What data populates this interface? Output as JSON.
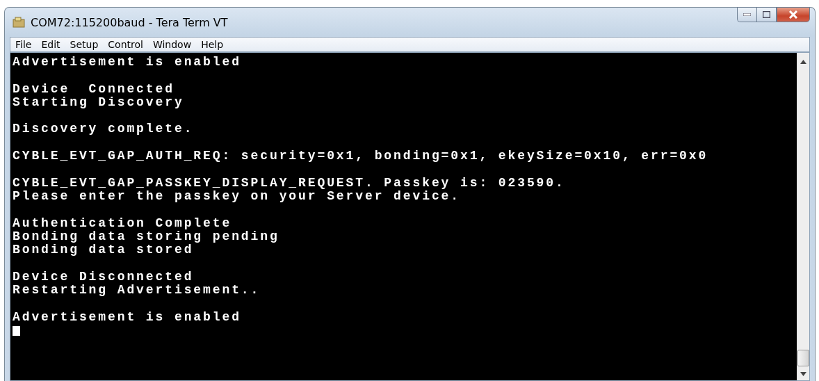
{
  "window": {
    "title": "COM72:115200baud - Tera Term VT"
  },
  "menu": [
    "File",
    "Edit",
    "Setup",
    "Control",
    "Window",
    "Help"
  ],
  "terminal": {
    "blocks": [
      [
        "Advertisement is enabled"
      ],
      [
        "Device  Connected",
        "Starting Discovery"
      ],
      [
        "Discovery complete."
      ],
      [
        "CYBLE_EVT_GAP_AUTH_REQ: security=0x1, bonding=0x1, ekeySize=0x10, err=0x0"
      ],
      [
        "CYBLE_EVT_GAP_PASSKEY_DISPLAY_REQUEST. Passkey is: 023590.",
        "Please enter the passkey on your Server device."
      ],
      [
        "Authentication Complete",
        "Bonding data storing pending",
        "Bonding data stored"
      ],
      [
        "Device Disconnected",
        "Restarting Advertisement.."
      ],
      [
        "Advertisement is enabled"
      ]
    ]
  }
}
